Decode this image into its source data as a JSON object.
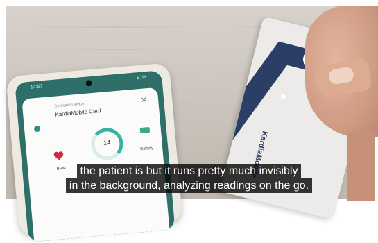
{
  "phone_screen": {
    "status_time": "14:53",
    "status_right": "57%",
    "selected_label": "Selected Device",
    "selected_device": "KardiaMobile Card",
    "reading_value": "14",
    "bpm_label": "-- BPM",
    "battery_label": "Battery"
  },
  "card": {
    "brand": "KardiaMobile"
  },
  "subtitles": {
    "line1": "the patient is but it runs pretty much invisibly",
    "line2": "in the background, analyzing readings on the go."
  },
  "colors": {
    "phone_accent": "#2e6f6a",
    "ring": "#35b3a0",
    "card_band": "#2b3e66",
    "subtitle_bg": "#080808"
  }
}
